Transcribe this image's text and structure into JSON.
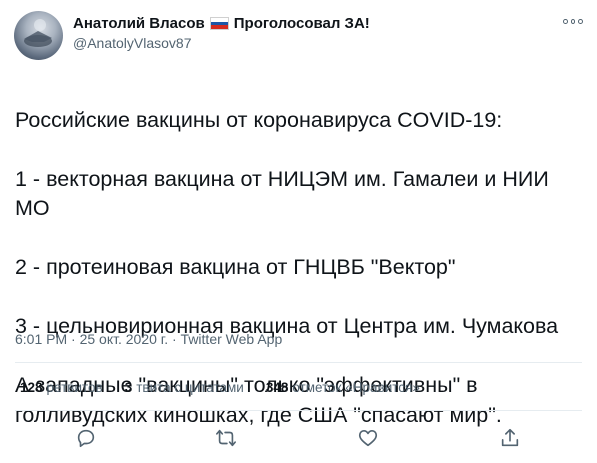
{
  "author": {
    "display_name": "Анатолий Власов",
    "name_suffix": "Проголосовал ЗА!",
    "handle": "@AnatolyVlasov87",
    "flag_icon": "russia-flag-icon",
    "avatar_icon": "avatar-photo"
  },
  "tweet": {
    "lines": [
      "Российские вакцины от коронавируса COVID-19:",
      "1 - векторная вакцина от НИЦЭМ им. Гамалеи и НИИ МО",
      "2 - протеиновая вакцина от ГНЦВБ \"Вектор\"",
      "3 - цельновирионная вакцина от Центра им. Чумакова",
      "А западные \"вакцины\" только \"эффективны\" в голливудских киношках, где США \"спасают мир\"."
    ]
  },
  "meta": {
    "time": "6:01 PM",
    "date": "25 окт. 2020 г.",
    "separator": "·",
    "source": "Twitter Web App"
  },
  "stats": {
    "retweets_count": "128",
    "retweets_label": "ретвитов",
    "quotes_count": "3",
    "quotes_label": "твита с цитатами",
    "likes_count": "348",
    "likes_label": "отметок «Нравится»"
  },
  "actions": {
    "reply_icon": "reply-icon",
    "retweet_icon": "retweet-icon",
    "like_icon": "heart-icon",
    "share_icon": "share-icon"
  },
  "colors": {
    "text": "#0f1419",
    "secondary": "#536471",
    "divider": "#e6ecf0"
  }
}
